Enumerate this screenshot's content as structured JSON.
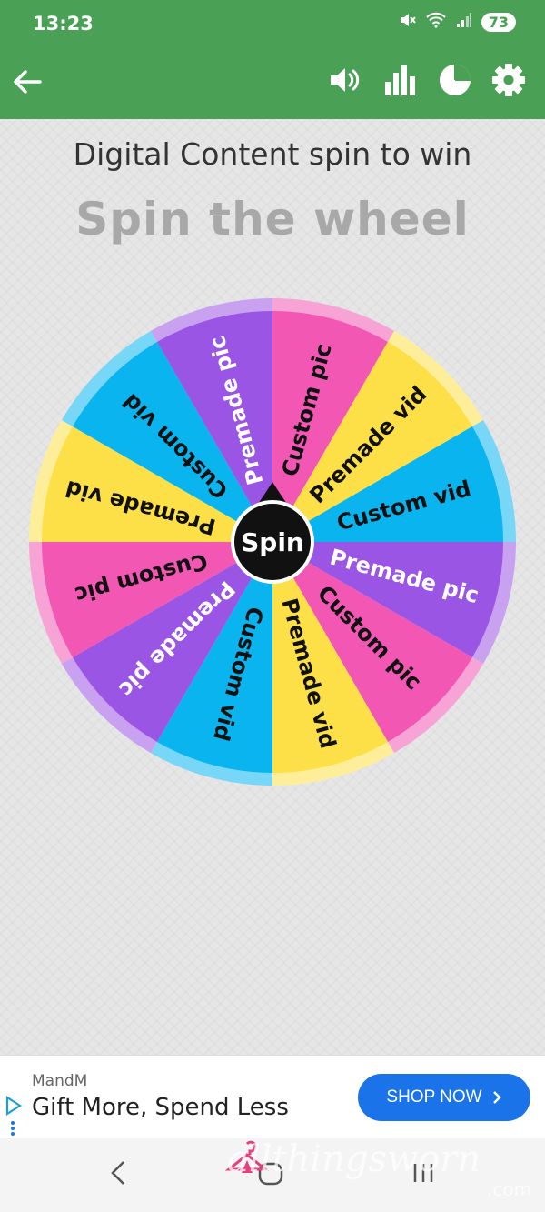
{
  "status_bar": {
    "time": "13:23",
    "battery": "73"
  },
  "toolbar": {
    "back_icon": "arrow-left-icon",
    "sound_icon": "speaker-icon",
    "stats_icon": "bar-chart-icon",
    "pie_icon": "pie-chart-icon",
    "settings_icon": "gear-icon"
  },
  "header": {
    "title": "Digital Content spin to win",
    "subtitle": "Spin the wheel"
  },
  "wheel": {
    "spin_label": "Spin",
    "segments": [
      {
        "label": "Custom pic",
        "color": "#f257b4",
        "text_color": "#111111"
      },
      {
        "label": "Premade vid",
        "color": "#fde047",
        "text_color": "#111111"
      },
      {
        "label": "Custom vid",
        "color": "#0ab4ef",
        "text_color": "#111111"
      },
      {
        "label": "Premade pic",
        "color": "#9b55e5",
        "text_color": "#ffffff"
      },
      {
        "label": "Custom pic",
        "color": "#f257b4",
        "text_color": "#111111"
      },
      {
        "label": "Premade vid",
        "color": "#fde047",
        "text_color": "#111111"
      },
      {
        "label": "Custom vid",
        "color": "#0ab4ef",
        "text_color": "#111111"
      },
      {
        "label": "Premade pic",
        "color": "#9b55e5",
        "text_color": "#ffffff"
      },
      {
        "label": "Custom pic",
        "color": "#f257b4",
        "text_color": "#111111"
      },
      {
        "label": "Premade vid",
        "color": "#fde047",
        "text_color": "#111111"
      },
      {
        "label": "Custom vid",
        "color": "#0ab4ef",
        "text_color": "#111111"
      },
      {
        "label": "Premade pic",
        "color": "#9b55e5",
        "text_color": "#ffffff"
      }
    ]
  },
  "ad": {
    "brand": "MandM",
    "text": "Gift More, Spend Less",
    "cta": "SHOP NOW"
  },
  "watermark": {
    "text": "allthingsworn",
    "suffix": ".com"
  },
  "colors": {
    "accent": "#4aa156",
    "cta": "#1a73e8"
  }
}
